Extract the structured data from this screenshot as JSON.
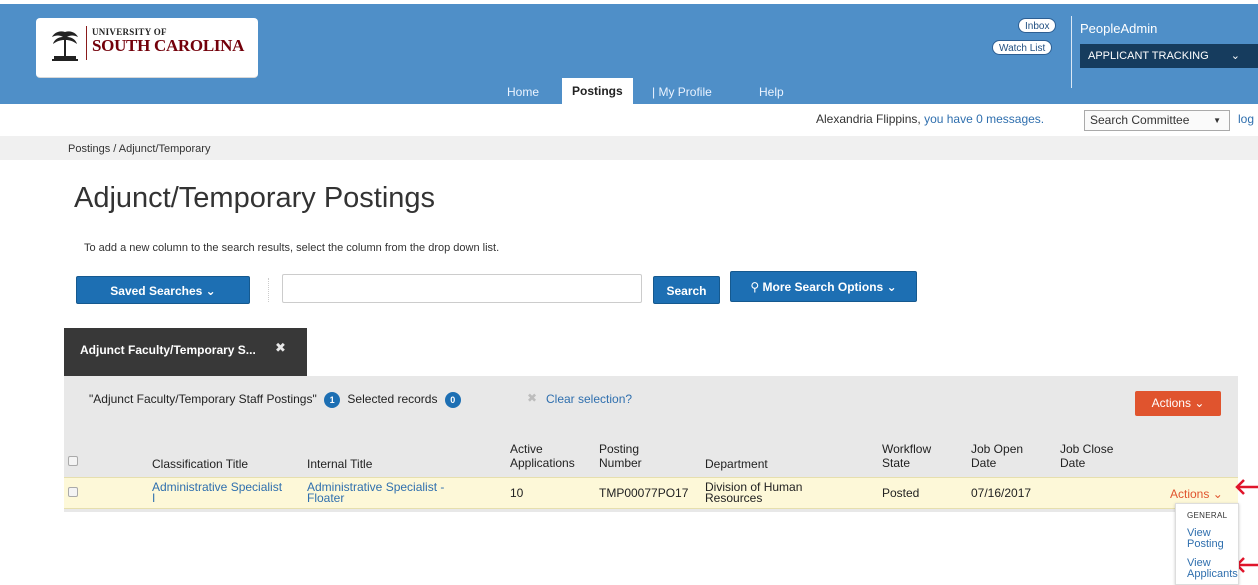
{
  "header": {
    "logo_line1": "UNIVERSITY OF",
    "logo_line2": "SOUTH CAROLINA",
    "inbox": "Inbox",
    "watch_list": "Watch List",
    "brand": "PeopleAdmin",
    "module_select": "APPLICANT TRACKING"
  },
  "nav": {
    "home": "Home",
    "postings": "Postings",
    "my_profile": "| My Profile",
    "help": "Help"
  },
  "user_bar": {
    "user_name": "Alexandria Flippins,",
    "messages_link": "you have 0 messages.",
    "role_select": "Search Committee",
    "logout": "log"
  },
  "breadcrumb": "Postings / Adjunct/Temporary",
  "page_title": "Adjunct/Temporary Postings",
  "hint": "To add a new column to the search results, select the column from the drop down list.",
  "search": {
    "saved_searches": "Saved Searches",
    "input_value": "",
    "search_button": "Search",
    "more_options": "More Search Options"
  },
  "saved_tab": {
    "label": "Adjunct Faculty/Temporary S..."
  },
  "results": {
    "title": "\"Adjunct Faculty/Temporary Staff Postings\"",
    "count": "1",
    "selected_label": "Selected records",
    "selected_count": "0",
    "clear_selection": "Clear selection?",
    "actions_label": "Actions",
    "columns": {
      "classification_title": "Classification Title",
      "internal_title": "Internal Title",
      "active_applications_1": "Active",
      "active_applications_2": "Applications",
      "posting_number_1": "Posting",
      "posting_number_2": "Number",
      "department": "Department",
      "workflow_state_1": "Workflow",
      "workflow_state_2": "State",
      "job_open_date_1": "Job Open",
      "job_open_date_2": "Date",
      "job_close_date_1": "Job Close",
      "job_close_date_2": "Date"
    },
    "rows": [
      {
        "classification_title_1": "Administrative Specialist",
        "classification_title_2": "I",
        "internal_title_1": "Administrative Specialist -",
        "internal_title_2": "Floater",
        "active_applications": "10",
        "posting_number": "TMP00077PO17",
        "department_1": "Division of Human",
        "department_2": "Resources",
        "workflow_state": "Posted",
        "job_open_date": "07/16/2017",
        "job_close_date": "",
        "actions": "Actions"
      }
    ]
  },
  "row_menu": {
    "heading": "GENERAL",
    "view_posting_1": "View",
    "view_posting_2": "Posting",
    "view_applicants_1": "View",
    "view_applicants_2": "Applicants"
  },
  "colors": {
    "header_blue": "#4f8fc8",
    "button_blue": "#1d6fb3",
    "actions_orange": "#e0542e",
    "annotation_red": "#e0142a",
    "row_highlight": "#fdf8d8"
  }
}
